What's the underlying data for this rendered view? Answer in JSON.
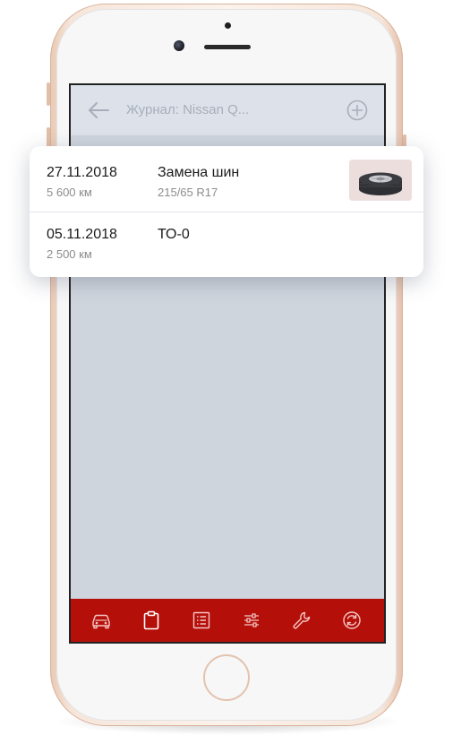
{
  "header": {
    "title": "Журнал: Nissan Q..."
  },
  "entries": [
    {
      "date": "27.11.2018",
      "mileage": "5 600 км",
      "title": "Замена шин",
      "subtitle": "215/65 R17",
      "thumbnail": "tire-photo"
    },
    {
      "date": "05.11.2018",
      "mileage": "2 500 км",
      "title": "ТО-0",
      "subtitle": ""
    }
  ],
  "tabbar": {
    "items": [
      {
        "icon": "car-icon",
        "active": false
      },
      {
        "icon": "clipboard-icon",
        "active": true
      },
      {
        "icon": "list-icon",
        "active": false
      },
      {
        "icon": "sliders-icon",
        "active": false
      },
      {
        "icon": "wrench-icon",
        "active": false
      },
      {
        "icon": "refresh-icon",
        "active": false
      }
    ]
  },
  "colors": {
    "accent": "#b50f0a",
    "screen_bg": "#cfd5dd",
    "header_bg": "#dde1e9",
    "muted_text": "#8c8c8c"
  }
}
